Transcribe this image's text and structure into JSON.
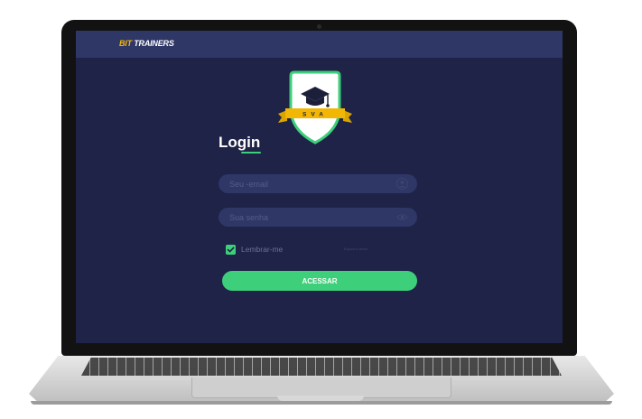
{
  "app": {
    "brand_prefix": "BIT",
    "brand_suffix": "TRAINERS",
    "logo_text": "SVA"
  },
  "login": {
    "title": "Login",
    "email_placeholder": "Seu -email",
    "password_placeholder": "Sua senha",
    "remember_label": "Lembrar-me",
    "forgot_label": "Esqueci a senha",
    "submit_label": "ACESSAR",
    "remember_checked": true
  },
  "colors": {
    "background": "#1f2347",
    "topbar": "#2f3767",
    "accent": "#3ecf7b",
    "brand_yellow": "#f2b705"
  },
  "icons": {
    "email_field": "user-icon",
    "password_field": "eye-icon",
    "logo": "graduation-cap-icon"
  }
}
